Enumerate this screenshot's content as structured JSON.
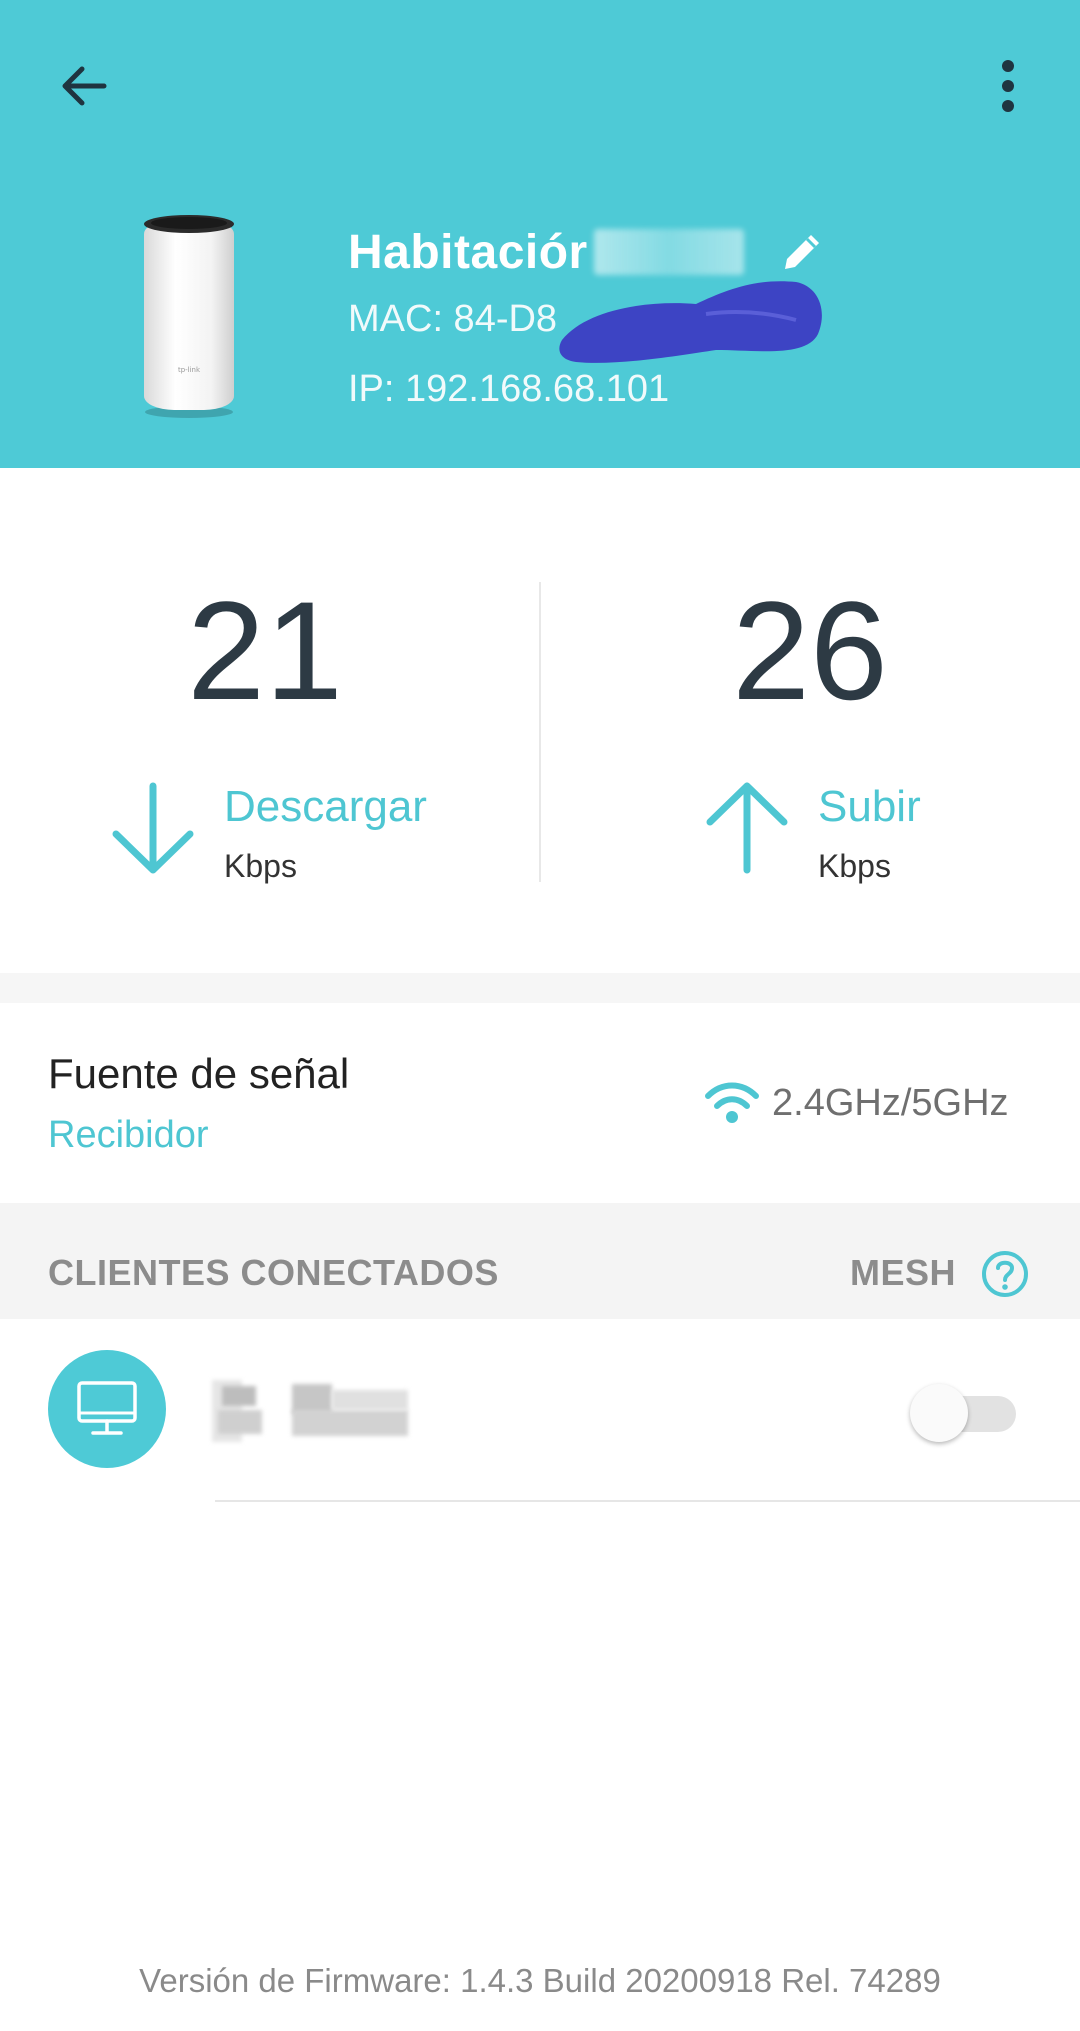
{
  "header": {
    "back_icon": "arrow-left-icon",
    "more_icon": "more-vertical-icon",
    "device_name": "Habitacion",
    "device_name_display": "Habitació",
    "device_name_tail": "r",
    "edit_icon": "pencil-icon",
    "mac_label": "MAC: 84-D8",
    "ip_label": "IP: 192.168.68.101",
    "background_color": "#4ecad6"
  },
  "speeds": {
    "download": {
      "value": "21",
      "label": "Descargar",
      "unit": "Kbps",
      "icon": "arrow-down-icon"
    },
    "upload": {
      "value": "26",
      "label": "Subir",
      "unit": "Kbps",
      "icon": "arrow-up-icon"
    }
  },
  "signal": {
    "title": "Fuente de señal",
    "source": "Recibidor",
    "band_icon": "wifi-icon",
    "band": "2.4GHz/5GHz"
  },
  "clients": {
    "title": "CLIENTES CONECTADOS",
    "mesh_label": "MESH",
    "help_icon": "help-circle-icon",
    "items": [
      {
        "icon": "desktop-icon",
        "toggle_on": false
      }
    ]
  },
  "footer": {
    "firmware": "Versión de Firmware: 1.4.3 Build 20200918 Rel. 74289"
  },
  "colors": {
    "accent": "#4ecad6",
    "text_dark": "#2d3a44"
  }
}
